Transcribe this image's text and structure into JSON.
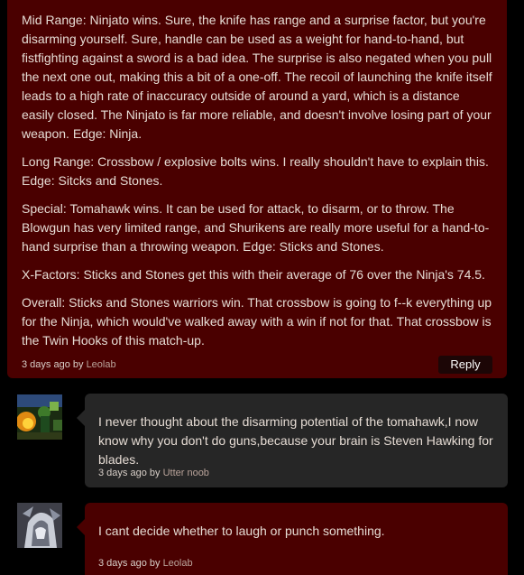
{
  "main_comment": {
    "paragraphs": [
      "Mid Range: Ninjato wins. Sure, the knife has range and a surprise factor, but you're disarming yourself. Sure, handle can be used as a weight for hand-to-hand, but fistfighting against a sword is a bad idea. The surprise is also negated when you pull the next one out, making this a bit of a one-off. The recoil of launching the knife itself leads to a high rate of inaccuracy outside of around a yard, which is a distance easily closed. The Ninjato is far more reliable, and doesn't involve losing part of your weapon. Edge: Ninja.",
      "Long Range: Crossbow / explosive bolts wins. I really shouldn't have to explain this. Edge: Sitcks and Stones.",
      "Special: Tomahawk wins. It can be used for attack, to disarm, or to throw. The Blowgun has very limited range, and Shurikens are really more useful for a hand-to-hand surprise than a throwing weapon. Edge: Sticks and Stones.",
      "X-Factors: Sticks and Stones get this with their average of 76 over the Ninja's 74.5.",
      "Overall: Sticks and Stones warriors win. That crossbow is going to f--k everything up for the Ninja, which would've walked away with a win if not for that. That crossbow is the Twin Hooks of this match-up."
    ],
    "time": "3 days ago by",
    "author": "Leolab",
    "reply_label": "Reply"
  },
  "replies": [
    {
      "text": "I never thought about the disarming potential of the tomahawk,I now know why you don't do guns,because your brain is Steven Hawking for blades.",
      "time": "3 days ago by",
      "author": "Utter noob",
      "avatar_icon": "avatar-warrior-fire"
    },
    {
      "text": "I cant decide whether to laugh or punch something.",
      "time": "3 days ago by",
      "author": "Leolab",
      "avatar_icon": "avatar-hooded-figure"
    }
  ],
  "colors": {
    "page_background": "#000000",
    "main_comment_background": "#4a0000",
    "reply_dark_background": "#262626",
    "reply_red_background": "#4a0000",
    "text": "#e6dcd4",
    "author_link": "#b9a39a"
  }
}
